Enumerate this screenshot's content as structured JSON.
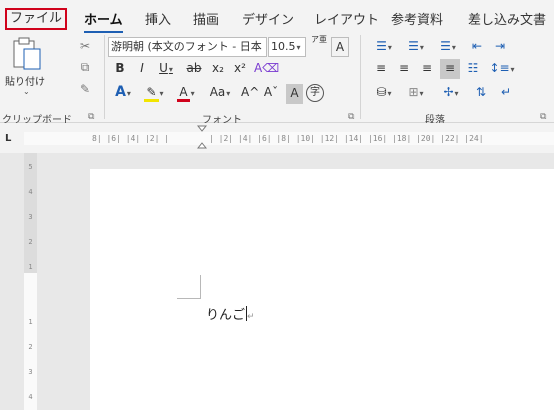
{
  "tabs": [
    "ファイル",
    "ホーム",
    "挿入",
    "描画",
    "デザイン",
    "レイアウト",
    "参考資料",
    "差し込み文書"
  ],
  "clipboard": {
    "paste_label": "貼り付け",
    "group_label": "クリップボード"
  },
  "font": {
    "name_value": "游明朝 (本文のフォント - 日本",
    "size_value": "10.5",
    "group_label": "フォント",
    "furigana_icon": "ア亜",
    "border_char_icon": "A",
    "bold": "B",
    "italic": "I",
    "underline": "U",
    "strike": "ab",
    "subscript": "x₂",
    "superscript": "x²",
    "text_effect": "A",
    "font_color": "A",
    "change_case": "Aa",
    "grow_font": "A^",
    "shrink_font": "Aˇ",
    "char_shading": "A",
    "enclose_char": "字",
    "highlight_color": "#f2e500",
    "font_color_value": "#d0021b"
  },
  "paragraph": {
    "group_label": "段落"
  },
  "ruler": {
    "ticks": "8| |6| |4| |2| |",
    "ticks_right": "| |2| |4| |6| |8| |10| |12| |14| |16| |18| |20| |22| |24|"
  },
  "vruler_ticks": [
    "5",
    "4",
    "3",
    "2",
    "1",
    "1",
    "2",
    "3",
    "4"
  ],
  "document": {
    "text": "りんご",
    "para_mark": "↵"
  },
  "colors": {
    "accent": "#1e5fb3",
    "file_outline": "#d0021b"
  }
}
